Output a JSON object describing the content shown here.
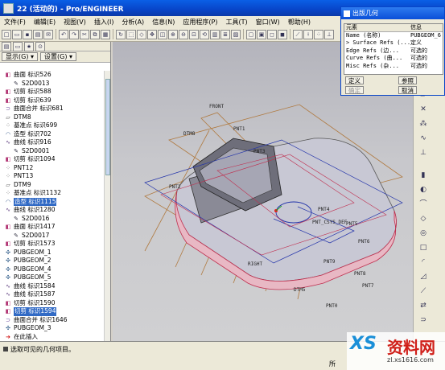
{
  "window": {
    "title": "22 (活动的) - Pro/ENGINEER"
  },
  "menu": [
    "文件(F)",
    "编辑(E)",
    "视图(V)",
    "插入(I)",
    "分析(A)",
    "信息(N)",
    "应用程序(P)",
    "工具(T)",
    "窗口(W)",
    "帮助(H)"
  ],
  "tree": {
    "show_label": "显示(G) ▾",
    "settings_label": "设置(G) ▾",
    "items": [
      {
        "icon": "cut",
        "label": "曲面 标识526",
        "sel": false
      },
      {
        "icon": "sketch",
        "label": "S2D0013",
        "sel": false,
        "indent": true
      },
      {
        "icon": "cut",
        "label": "切剪 标识588",
        "sel": false
      },
      {
        "icon": "cut",
        "label": "切剪 标识639",
        "sel": false
      },
      {
        "icon": "merge",
        "label": "曲面合并 标识681",
        "sel": false
      },
      {
        "icon": "plane",
        "label": "DTM8",
        "sel": false
      },
      {
        "icon": "point",
        "label": "基准点 标识699",
        "sel": false
      },
      {
        "icon": "style",
        "label": "造型 标识702",
        "sel": false
      },
      {
        "icon": "curve",
        "label": "曲线 标识916",
        "sel": false
      },
      {
        "icon": "sketch",
        "label": "S2D0001",
        "sel": false,
        "indent": true
      },
      {
        "icon": "cut",
        "label": "切剪 标识1094",
        "sel": false
      },
      {
        "icon": "point",
        "label": "PNT12",
        "sel": false
      },
      {
        "icon": "point",
        "label": "PNT13",
        "sel": false
      },
      {
        "icon": "plane",
        "label": "DTM9",
        "sel": false
      },
      {
        "icon": "point",
        "label": "基准点 标识1132",
        "sel": false
      },
      {
        "icon": "style",
        "label": "造型 标识1115",
        "sel": true
      },
      {
        "icon": "curve",
        "label": "曲线 标识1280",
        "sel": false
      },
      {
        "icon": "sketch",
        "label": "S2D0016",
        "sel": false,
        "indent": true
      },
      {
        "icon": "cut",
        "label": "曲面 标识1417",
        "sel": false
      },
      {
        "icon": "sketch",
        "label": "S2D0017",
        "sel": false,
        "indent": true
      },
      {
        "icon": "cut",
        "label": "切剪 标识1573",
        "sel": false
      },
      {
        "icon": "geom",
        "label": "PUBGEOM_1",
        "sel": false
      },
      {
        "icon": "geom",
        "label": "PUBGEOM_2",
        "sel": false
      },
      {
        "icon": "geom",
        "label": "PUBGEOM_4",
        "sel": false
      },
      {
        "icon": "geom",
        "label": "PUBGEOM_5",
        "sel": false
      },
      {
        "icon": "curve",
        "label": "曲线 标识1584",
        "sel": false
      },
      {
        "icon": "curve",
        "label": "曲线 标识1587",
        "sel": false
      },
      {
        "icon": "cut",
        "label": "切剪 标识1590",
        "sel": false
      },
      {
        "icon": "cut",
        "label": "切剪 标识1594",
        "sel": true
      },
      {
        "icon": "merge",
        "label": "曲面合并 标识1646",
        "sel": false
      },
      {
        "icon": "geom",
        "label": "PUBGEOM_3",
        "sel": false
      },
      {
        "icon": "insert",
        "label": "在此插入",
        "sel": false
      }
    ]
  },
  "dialog": {
    "title": "出版几何",
    "col1": "元素",
    "col2": "信息",
    "rows": [
      {
        "name": "Name (名称)",
        "info": "PUBGEOM_6"
      },
      {
        "name": "Surface Refs (...",
        "info": "定义"
      },
      {
        "name": "Edge Refs (边...",
        "info": "可选的"
      },
      {
        "name": "Curve Refs (曲...",
        "info": "可选的"
      },
      {
        "name": "Misc Refs (杂...",
        "info": "可选的"
      }
    ],
    "btn_define": "定义",
    "btn_refs": "参照",
    "btn_ok": "确定",
    "btn_cancel": "取消"
  },
  "viewport_labels": [
    "FRONT",
    "PNT1",
    "DTM8",
    "PNT2",
    "RIGHT",
    "DTM5",
    "PNT0",
    "PNT3",
    "PNT_CSYS_DEF",
    "PNT4",
    "PNT5",
    "PNT6",
    "PNT9",
    "PNT8",
    "PNT7"
  ],
  "status": {
    "message": "选取可见的几何项目。",
    "filter": "所"
  },
  "watermark": {
    "brand": "XS",
    "name": "资料网",
    "url": "zl.xs1616.com"
  }
}
